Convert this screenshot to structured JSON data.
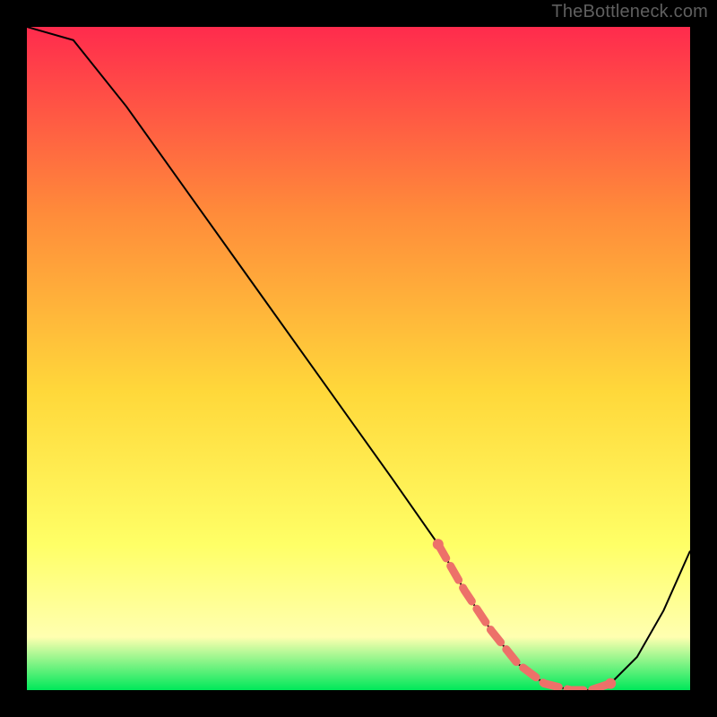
{
  "watermark": "TheBottleneck.com",
  "colors": {
    "bg": "#000000",
    "watermark": "#5f5f5f",
    "curve": "#000000",
    "flat_band": "#ed7169",
    "grad_top": "#ff2b4d",
    "grad_mid1": "#ff8b3a",
    "grad_mid2": "#ffd83a",
    "grad_mid3": "#ffff66",
    "grad_mid4": "#ffffb0",
    "grad_bot": "#00e85a"
  },
  "chart_data": {
    "type": "line",
    "title": "",
    "xlabel": "",
    "ylabel": "",
    "xlim": [
      0,
      100
    ],
    "ylim": [
      0,
      100
    ],
    "x": [
      0,
      7,
      15,
      25,
      35,
      45,
      55,
      62,
      66,
      70,
      74,
      78,
      82,
      85,
      88,
      92,
      96,
      100
    ],
    "y": [
      100,
      98,
      88,
      74,
      60,
      46,
      32,
      22,
      15,
      9,
      4,
      1,
      0,
      0,
      1,
      5,
      12,
      21
    ],
    "flat_region": {
      "x": [
        62,
        66,
        70,
        74,
        78,
        82,
        85,
        88
      ],
      "y": [
        22,
        15,
        9,
        4,
        1,
        0,
        0,
        1
      ]
    }
  }
}
